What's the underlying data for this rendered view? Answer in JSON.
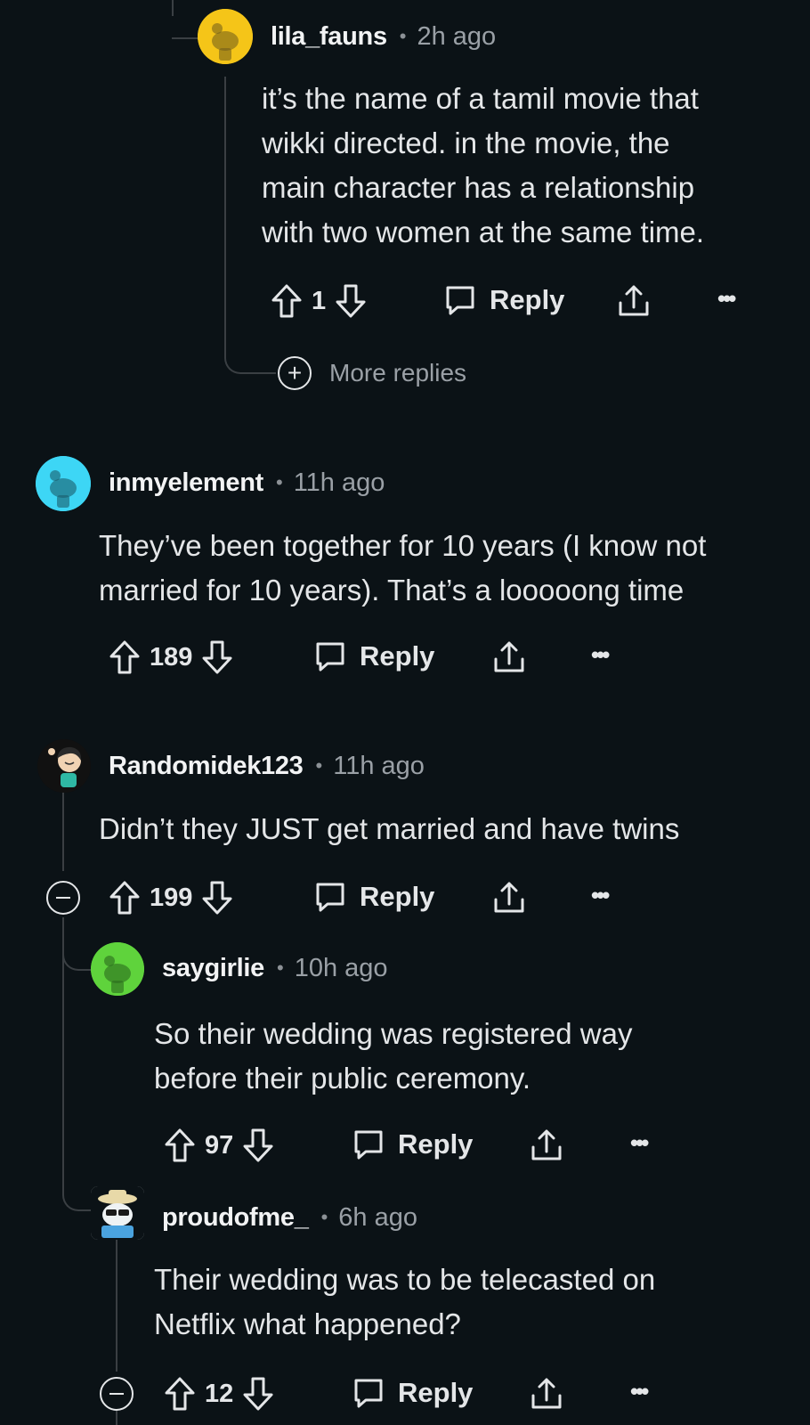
{
  "comments": [
    {
      "username": "lila_fauns",
      "time": "2h ago",
      "body": [
        "it’s the name of a tamil movie that",
        "wikki directed. in the movie, the",
        "main character has a relationship",
        "with two women at the same time."
      ],
      "votes": "1",
      "reply_label": "Reply",
      "avatar_color": "#f5c518",
      "more_replies": "More replies"
    },
    {
      "username": "inmyelement",
      "time": "11h ago",
      "body": [
        "They’ve been together for 10 years (I know not",
        "married for 10 years). That’s a looooong time"
      ],
      "votes": "189",
      "reply_label": "Reply",
      "avatar_color": "#3dd6f5"
    },
    {
      "username": "Randomidek123",
      "time": "11h ago",
      "body": [
        "Didn’t they JUST get married and have twins"
      ],
      "votes": "199",
      "reply_label": "Reply",
      "avatar_color": "#111111"
    },
    {
      "username": "saygirlie",
      "time": "10h ago",
      "body": [
        "So their wedding was registered way",
        "before their public ceremony."
      ],
      "votes": "97",
      "reply_label": "Reply",
      "avatar_color": "#5fd33c"
    },
    {
      "username": "proudofme_",
      "time": "6h ago",
      "body": [
        "Their wedding was to be telecasted on",
        "Netflix what happened?"
      ],
      "votes": "12",
      "reply_label": "Reply",
      "avatar_color": "#dfe7ea"
    }
  ],
  "icons": {
    "upvote": "upvote-arrow-icon",
    "downvote": "downvote-arrow-icon",
    "reply": "speech-bubble-icon",
    "share": "share-icon",
    "more": "ellipsis-icon",
    "expand": "plus-circle-icon",
    "collapse": "minus-circle-icon"
  },
  "colors": {
    "background": "#0b1216",
    "thread_line": "#3a3f43",
    "text": "#e4e6e8",
    "meta": "#9aa0a6"
  }
}
